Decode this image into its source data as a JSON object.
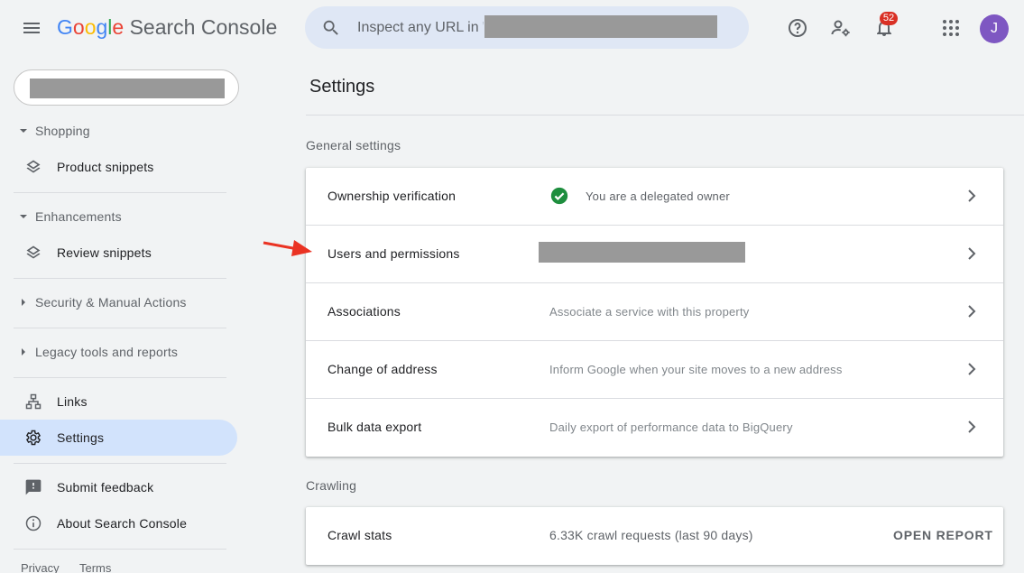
{
  "header": {
    "logo_google": [
      "G",
      "o",
      "o",
      "g",
      "l",
      "e"
    ],
    "logo_product": "Search Console",
    "search_placeholder": "Inspect any URL in \"",
    "notifications_count": "52",
    "avatar_letter": "J",
    "icons": [
      "menu-icon",
      "search-icon",
      "help-icon",
      "manage-accounts-icon",
      "notifications-bell-icon",
      "apps-grid-icon"
    ]
  },
  "sidebar": {
    "sections": [
      {
        "label": "Shopping",
        "expanded": true,
        "items": [
          {
            "label": "Product snippets",
            "icon": "layers-icon"
          }
        ]
      },
      {
        "label": "Enhancements",
        "expanded": true,
        "items": [
          {
            "label": "Review snippets",
            "icon": "layers-icon"
          }
        ]
      },
      {
        "label": "Security & Manual Actions",
        "expanded": false,
        "items": []
      },
      {
        "label": "Legacy tools and reports",
        "expanded": false,
        "items": []
      }
    ],
    "links": {
      "label": "Links",
      "icon": "links-tree-icon"
    },
    "settings": {
      "label": "Settings",
      "icon": "gear-icon",
      "active": true
    },
    "feedback": {
      "label": "Submit feedback",
      "icon": "feedback-icon"
    },
    "about": {
      "label": "About Search Console",
      "icon": "info-icon"
    },
    "footer": {
      "privacy": "Privacy",
      "terms": "Terms"
    }
  },
  "main": {
    "title": "Settings",
    "general_title": "General settings",
    "general_rows": [
      {
        "label": "Ownership verification",
        "desc": "You are a delegated owner",
        "status_icon": "check-circle-icon"
      },
      {
        "label": "Users and permissions",
        "desc": ""
      },
      {
        "label": "Associations",
        "desc": "Associate a service with this property"
      },
      {
        "label": "Change of address",
        "desc": "Inform Google when your site moves to a new address"
      },
      {
        "label": "Bulk data export",
        "desc": "Daily export of performance data to BigQuery"
      }
    ],
    "crawling_title": "Crawling",
    "crawl_row": {
      "label": "Crawl stats",
      "desc": "6.33K crawl requests (last 90 days)",
      "action": "OPEN REPORT"
    }
  },
  "colors": {
    "accent": "#1a73e8",
    "active_nav": "#d2e3fc",
    "check_green": "#1e8e3e",
    "badge_red": "#d93025",
    "avatar": "#7e57c2",
    "annotation_arrow": "#ea3323"
  }
}
